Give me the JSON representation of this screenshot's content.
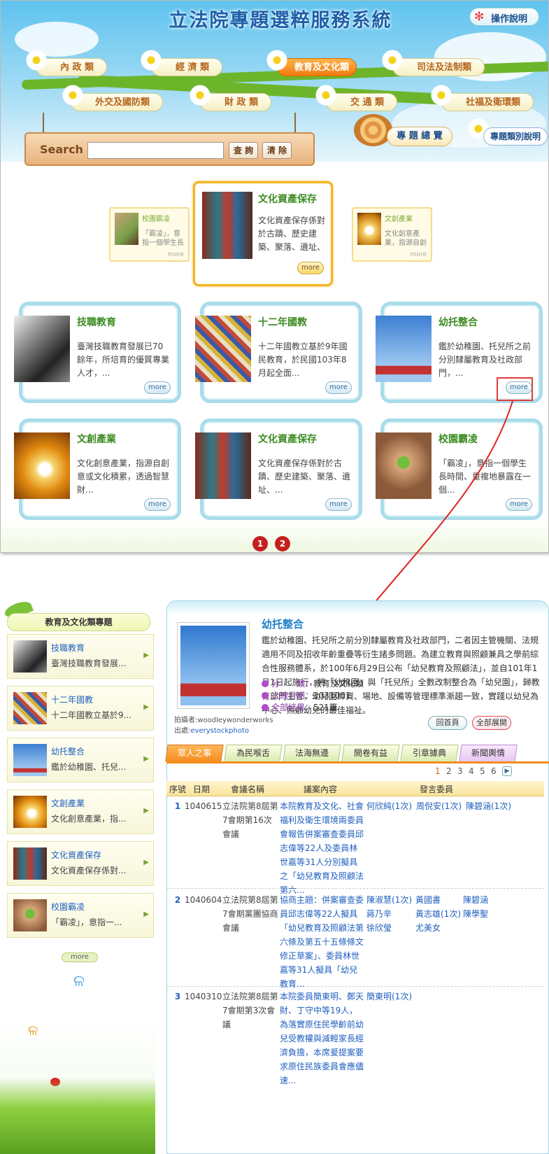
{
  "top": {
    "site_title": "立法院專題選粹服務系統",
    "help_label": "操作說明",
    "categories": [
      "內 政 類",
      "經 濟 類",
      "教育及文化類",
      "司法及法制類",
      "外交及國防類",
      "財 政 類",
      "交 通 類",
      "社福及衛環類"
    ],
    "search": {
      "label": "Search",
      "query_btn": "查 詢",
      "clear_btn": "清 除",
      "value": ""
    },
    "special_overview": "專 題 總 覽",
    "special_desc": "專題類別說明",
    "featured": {
      "left": {
        "title": "校園霸凌",
        "desc": "「霸凌」，意指一個學生長",
        "more": "more"
      },
      "main": {
        "title": "文化資產保存",
        "desc": "文化資產保存係對於古蹟、歷史建築、聚落、遺址、文化景",
        "more": "more"
      },
      "right": {
        "title": "文創產業",
        "desc": "文化創意產業，指源自創",
        "more": "more"
      }
    },
    "cards": [
      {
        "title": "技職教育",
        "desc": "臺灣技職教育發展已70餘年，所培育的優質專業人才，...",
        "more": "more"
      },
      {
        "title": "十二年國教",
        "desc": "十二年國教立基於9年國民教育，於民國103年8月起全面...",
        "more": "more"
      },
      {
        "title": "幼托整合",
        "desc": "鑑於幼稚園、托兒所之前分別隸屬教育及社政部門，...",
        "more": "more"
      },
      {
        "title": "文創產業",
        "desc": "文化創意產業，指源自創意或文化積累，透過智慧財...",
        "more": "more"
      },
      {
        "title": "文化資產保存",
        "desc": "文化資產保存係對於古蹟、歷史建築、聚落、遺址、...",
        "more": "more"
      },
      {
        "title": "校園霸凌",
        "desc": "「霸凌」，意指一個學生長時間、重複地暴露在一個...",
        "more": "more"
      }
    ],
    "pages": [
      "1",
      "2"
    ]
  },
  "left": {
    "title": "教育及文化類專題",
    "items": [
      {
        "title": "技職教育",
        "desc": "臺灣技職教育發展..."
      },
      {
        "title": "十二年國教",
        "desc": "十二年國教立基於9..."
      },
      {
        "title": "幼托整合",
        "desc": "鑑於幼稚園、托兒..."
      },
      {
        "title": "文創產業",
        "desc": "文化創意產業，指..."
      },
      {
        "title": "文化資產保存",
        "desc": "文化資產保存係對..."
      },
      {
        "title": "校園霸凌",
        "desc": "「霸凌」，意指一..."
      }
    ],
    "more": "more"
  },
  "article": {
    "title": "幼托整合",
    "body": "鑑於幼稚園、托兒所之前分別隸屬教育及社政部門，二者因主管機關、法規適用不同及招收年齡重疊等衍生諸多問題。為建立教育與照顧兼具之學前綜合性服務體系，於100年6月29日公布「幼兒教育及照顧法」，並自101年1月1日起施行，將「幼稚園」與「托兒所」全數改制整合為「幼兒園」，歸教育部門主管，幼兒園師資、場地、設備等管理標準漸趨一致，實踐以幼兒為中心、照顧幼兒的最佳福祉。",
    "credit_author": "拍攝者:woodleywonderworks",
    "credit_source_label": "出處:",
    "credit_source": "everystockphoto",
    "meta": [
      {
        "label": "分　　類：",
        "value": "教育及文化類"
      },
      {
        "label": "上線日期：",
        "value": "1031001"
      },
      {
        "label": "全部結果：",
        "value": "521筆"
      }
    ],
    "btn_home": "回首頁",
    "btn_expand": "全部展開"
  },
  "tabs": [
    "眾人之事",
    "為民喉舌",
    "法海無邊",
    "開卷有益",
    "引章據典",
    "新聞輿情"
  ],
  "pagination": [
    "1",
    "2",
    "3",
    "4",
    "5",
    "6"
  ],
  "table": {
    "headers": [
      "序號",
      "日期",
      "會議名稱",
      "議案內容",
      "發言委員"
    ],
    "rows": [
      {
        "no": "1",
        "date": "1040615",
        "meeting": "立法院第8屆第7會期第16次會議",
        "content": "本院教育及文化、社會福利及衛生環境兩委員會報告併案審查委員邱志偉等22人及委員林世嘉等31人分別擬具之「幼兒教育及照顧法第六...",
        "members": [
          "何欣純(1次)",
          "周倪安(1次)",
          "陳碧涵(1次)"
        ]
      },
      {
        "no": "2",
        "date": "1040604",
        "meeting": "立法院第8屆第7會期黨團協商會議",
        "content": "協商主題：併案審查委員邱志偉等22人擬具「幼兒教育及照顧法第六條及第五十五條條文修正草案」、委員林世嘉等31人擬具「幼兒教育...",
        "members": [
          "陳淑慧(1次)",
          "黃國書",
          "陳碧涵",
          "蔣乃辛",
          "黃志雄(1次)",
          "陳學聖",
          "徐欣瑩",
          "尤美女"
        ]
      },
      {
        "no": "3",
        "date": "1040310",
        "meeting": "立法院第8屆第7會期第3次會議",
        "content": "本院委員簡東明、鄭天財、丁守中等19人，為落實原住民學齡前幼兒受教權與減輕家長經濟負擔，本席爰提案要求原住民族委員會應儘速...",
        "members": [
          "簡東明(1次)"
        ]
      }
    ]
  },
  "colors": {
    "accent": "#f48c1f",
    "link": "#2060c0",
    "green": "#3c8c22",
    "highlight": "#e23a3a"
  },
  "icons": [
    "pinwheel-icon",
    "snail-icon",
    "chevron-right-icon",
    "ladybug-icon",
    "butterfly-icon"
  ]
}
